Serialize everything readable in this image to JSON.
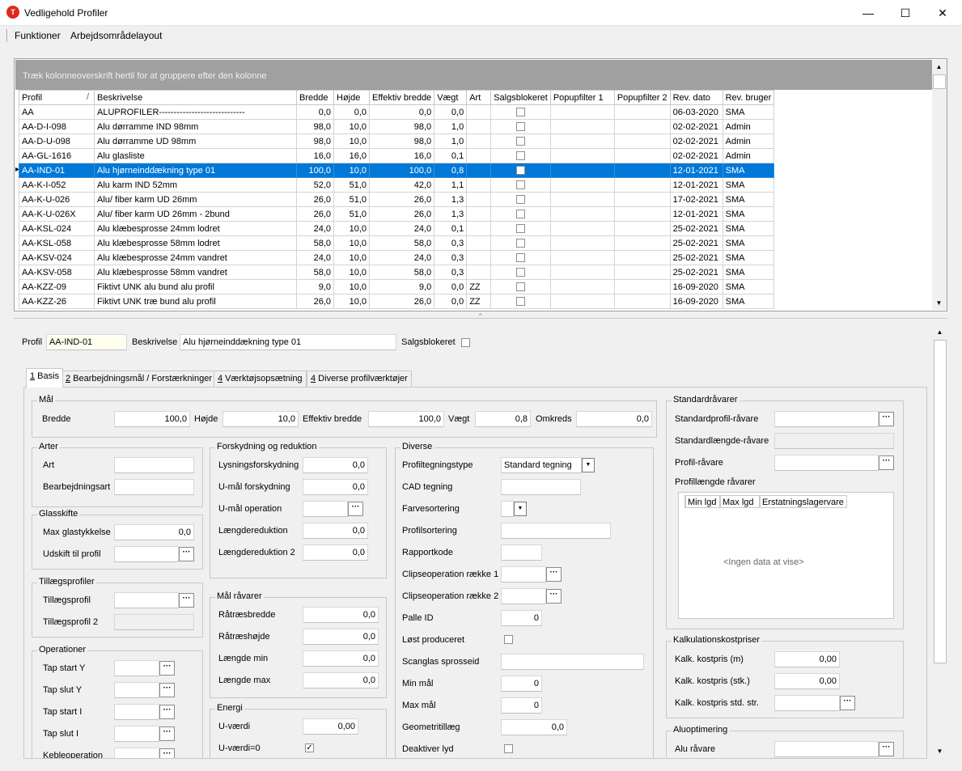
{
  "window": {
    "title": "Vedligehold Profiler",
    "icon_text": "T",
    "minimize": "—",
    "maximize": "☐",
    "close": "✕"
  },
  "menu": [
    "Funktioner",
    "Arbejdsområdelayout"
  ],
  "grid": {
    "group_hint": "Træk kolonneoverskrift hertil for at gruppere efter den kolonne",
    "columns": [
      "Profil",
      "Beskrivelse",
      "Bredde",
      "Højde",
      "Effektiv bredde",
      "Vægt",
      "Art",
      "Salgsblokeret",
      "Popupfilter 1",
      "Popupfilter 2",
      "Rev. dato",
      "Rev. bruger"
    ],
    "sort_indicator": "/",
    "selected_row": 4,
    "rows": [
      [
        "AA",
        "ALUPROFILER-----------------------------",
        "0,0",
        "0,0",
        "0,0",
        "0,0",
        "",
        "",
        "",
        "",
        "06-03-2020",
        "SMA"
      ],
      [
        "AA-D-I-098",
        "Alu dørramme IND 98mm",
        "98,0",
        "10,0",
        "98,0",
        "1,0",
        "",
        "",
        "",
        "",
        "02-02-2021",
        "Admin"
      ],
      [
        "AA-D-U-098",
        "Alu dørramme UD 98mm",
        "98,0",
        "10,0",
        "98,0",
        "1,0",
        "",
        "",
        "",
        "",
        "02-02-2021",
        "Admin"
      ],
      [
        "AA-GL-1616",
        "Alu glasliste",
        "16,0",
        "16,0",
        "16,0",
        "0,1",
        "",
        "",
        "",
        "",
        "02-02-2021",
        "Admin"
      ],
      [
        "AA-IND-01",
        "Alu hjørneinddækning type 01",
        "100,0",
        "10,0",
        "100,0",
        "0,8",
        "",
        "",
        "",
        "",
        "12-01-2021",
        "SMA"
      ],
      [
        "AA-K-I-052",
        "Alu karm IND 52mm",
        "52,0",
        "51,0",
        "42,0",
        "1,1",
        "",
        "",
        "",
        "",
        "12-01-2021",
        "SMA"
      ],
      [
        "AA-K-U-026",
        "Alu/ fiber karm UD 26mm",
        "26,0",
        "51,0",
        "26,0",
        "1,3",
        "",
        "",
        "",
        "",
        "17-02-2021",
        "SMA"
      ],
      [
        "AA-K-U-026X",
        "Alu/ fiber karm UD 26mm - 2bund",
        "26,0",
        "51,0",
        "26,0",
        "1,3",
        "",
        "",
        "",
        "",
        "12-01-2021",
        "SMA"
      ],
      [
        "AA-KSL-024",
        "Alu klæbesprosse 24mm lodret",
        "24,0",
        "10,0",
        "24,0",
        "0,1",
        "",
        "",
        "",
        "",
        "25-02-2021",
        "SMA"
      ],
      [
        "AA-KSL-058",
        "Alu klæbesprosse 58mm lodret",
        "58,0",
        "10,0",
        "58,0",
        "0,3",
        "",
        "",
        "",
        "",
        "25-02-2021",
        "SMA"
      ],
      [
        "AA-KSV-024",
        "Alu klæbesprosse 24mm vandret",
        "24,0",
        "10,0",
        "24,0",
        "0,3",
        "",
        "",
        "",
        "",
        "25-02-2021",
        "SMA"
      ],
      [
        "AA-KSV-058",
        "Alu klæbesprosse 58mm vandret",
        "58,0",
        "10,0",
        "58,0",
        "0,3",
        "",
        "",
        "",
        "",
        "25-02-2021",
        "SMA"
      ],
      [
        "AA-KZZ-09",
        "Fiktivt UNK alu bund alu profil",
        "9,0",
        "10,0",
        "9,0",
        "0,0",
        "ZZ",
        "",
        "",
        "",
        "16-09-2020",
        "SMA"
      ],
      [
        "AA-KZZ-26",
        "Fiktivt UNK træ bund alu profil",
        "26,0",
        "10,0",
        "26,0",
        "0,0",
        "ZZ",
        "",
        "",
        "",
        "16-09-2020",
        "SMA"
      ]
    ]
  },
  "header": {
    "profil_label": "Profil",
    "profil_value": "AA-IND-01",
    "beskrivelse_label": "Beskrivelse",
    "beskrivelse_value": "Alu hjørneinddækning type 01",
    "salgsblokeret_label": "Salgsblokeret"
  },
  "tabs": [
    {
      "key": "1",
      "label": " Basis"
    },
    {
      "key": "2",
      "label": " Bearbejdningsmål / Forstærkninger"
    },
    {
      "key": "4",
      "label": " Værktøjsopsætning"
    },
    {
      "key": "4",
      "label": " Diverse profilværktøjer"
    }
  ],
  "maal": {
    "title": "Mål",
    "bredde_label": "Bredde",
    "bredde": "100,0",
    "hoejde_label": "Højde",
    "hoejde": "10,0",
    "eff_label": "Effektiv bredde",
    "eff": "100,0",
    "vaegt_label": "Vægt",
    "vaegt": "0,8",
    "omkreds_label": "Omkreds",
    "omkreds": "0,0"
  },
  "arter": {
    "title": "Arter",
    "art_label": "Art",
    "art": "",
    "bearb_label": "Bearbejdningsart",
    "bearb": ""
  },
  "glasskifte": {
    "title": "Glasskifte",
    "max_label": "Max glastykkelse",
    "max": "0,0",
    "udskift_label": "Udskift til profil",
    "udskift": ""
  },
  "tillaeg": {
    "title": "Tillægsprofiler",
    "p1_label": "Tillægsprofil",
    "p2_label": "Tillægsprofil 2"
  },
  "operationer": {
    "title": "Operationer",
    "items": [
      "Tap start Y",
      "Tap slut Y",
      "Tap start I",
      "Tap slut I",
      "Kebleoperation"
    ]
  },
  "forskydning": {
    "title": "Forskydning og reduktion",
    "lys_label": "Lysningsforskydning",
    "lys": "0,0",
    "umaal_label": "U-mål forskydning",
    "umaal": "0,0",
    "uop_label": "U-mål operation",
    "laengde_label": "Længdereduktion",
    "laengde": "0,0",
    "laengde2_label": "Længdereduktion 2",
    "laengde2": "0,0"
  },
  "raavarer": {
    "title": "Mål råvarer",
    "rb_label": "Råtræsbredde",
    "rb": "0,0",
    "rh_label": "Råtræshøjde",
    "rh": "0,0",
    "lmin_label": "Længde min",
    "lmin": "0,0",
    "lmax_label": "Længde max",
    "lmax": "0,0"
  },
  "energi": {
    "title": "Energi",
    "u_label": "U-værdi",
    "u": "0,00",
    "u0_label": "U-værdi=0"
  },
  "diverse": {
    "title": "Diverse",
    "ptype_label": "Profiltegningstype",
    "ptype": "Standard tegning",
    "cad_label": "CAD tegning",
    "farve_label": "Farvesortering",
    "psort_label": "Profilsortering",
    "rapport_label": "Rapportkode",
    "clip1_label": "Clipseoperation række 1",
    "clip2_label": "Clipseoperation række 2",
    "palle_label": "Palle ID",
    "palle": "0",
    "loest_label": "Løst produceret",
    "scan_label": "Scanglas sprosseid",
    "min_label": "Min mål",
    "min": "0",
    "max_label": "Max mål",
    "max": "0",
    "geo_label": "Geometritillæg",
    "geo": "0,0",
    "deakt_label": "Deaktiver lyd"
  },
  "standard": {
    "title": "Standardråvarer",
    "sp_label": "Standardprofil-råvare",
    "sl_label": "Standardlængde-råvare",
    "pr_label": "Profil-råvare",
    "pl_label": "Profillængde råvarer",
    "cols": [
      "Min lgd",
      "Max lgd",
      "Erstatningslagervare"
    ],
    "nodata": "<Ingen data at vise>"
  },
  "kalk": {
    "title": "Kalkulationskostpriser",
    "m_label": "Kalk. kostpris (m)",
    "m": "0,00",
    "stk_label": "Kalk. kostpris (stk.)",
    "stk": "0,00",
    "std_label": "Kalk. kostpris std. str."
  },
  "alu": {
    "title": "Aluoptimering",
    "r_label": "Alu råvare"
  },
  "colors": {
    "selection": "#0078d7",
    "groupbar": "#a0a0a0"
  }
}
